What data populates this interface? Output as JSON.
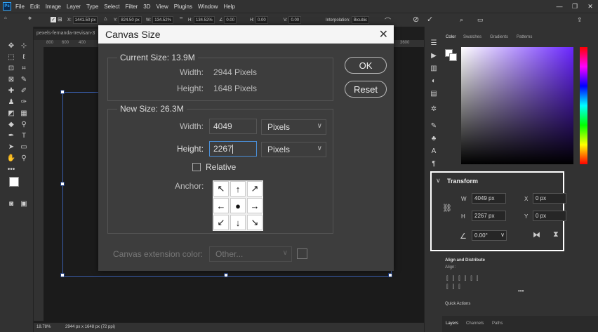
{
  "app": {
    "logo": "Ps",
    "menu": [
      "File",
      "Edit",
      "Image",
      "Layer",
      "Type",
      "Select",
      "Filter",
      "3D",
      "View",
      "Plugins",
      "Window",
      "Help"
    ]
  },
  "options_bar": {
    "x_label": "X:",
    "x_value": "1441.50 px",
    "y_label": "Y:",
    "y_value": "824.50 px",
    "w_label": "W:",
    "w_value": "134.52%",
    "h_label": "H:",
    "h_value": "134.52%",
    "angle_value": "0.00",
    "hskew_label": "H:",
    "hskew_value": "0.00",
    "vskew_label": "V:",
    "vskew_value": "0.00",
    "interp_label": "Interpolation:",
    "interp_value": "Bicubic"
  },
  "document": {
    "tab_title": "pexels-fernanda-trevisan-3",
    "ruler_marks": [
      "800",
      "600",
      "400",
      "3600"
    ],
    "zoom": "18.78%",
    "doc_info": "2944 px x 1648 px (72 ppi)"
  },
  "dialog": {
    "title": "Canvas Size",
    "current_size_label": "Current Size: 13.9M",
    "current_width_label": "Width:",
    "current_width_value": "2944 Pixels",
    "current_height_label": "Height:",
    "current_height_value": "1648 Pixels",
    "new_size_label": "New Size: 26.3M",
    "width_label": "Width:",
    "width_value": "4049",
    "width_unit": "Pixels",
    "height_label": "Height:",
    "height_value": "2267",
    "height_unit": "Pixels",
    "relative_label": "Relative",
    "anchor_label": "Anchor:",
    "extension_label": "Canvas extension color:",
    "extension_value": "Other...",
    "ok_label": "OK",
    "reset_label": "Reset"
  },
  "panels": {
    "color_tabs": [
      "Color",
      "Swatches",
      "Gradients",
      "Patterns"
    ],
    "transform_title": "Transform",
    "w_label": "W",
    "w_value": "4049 px",
    "h_label": "H",
    "h_value": "2267 px",
    "x_label": "X",
    "x_value": "0 px",
    "y_label": "Y",
    "y_value": "0 px",
    "angle_value": "0.00°",
    "align_title": "Align and Distribute",
    "align_sub": "Align:",
    "quick_actions": "Quick Actions",
    "bottom_tabs": [
      "Layers",
      "Channels",
      "Paths"
    ]
  },
  "colors": {
    "accent": "#31a8ff",
    "picker_hue": "#6a26ff"
  }
}
